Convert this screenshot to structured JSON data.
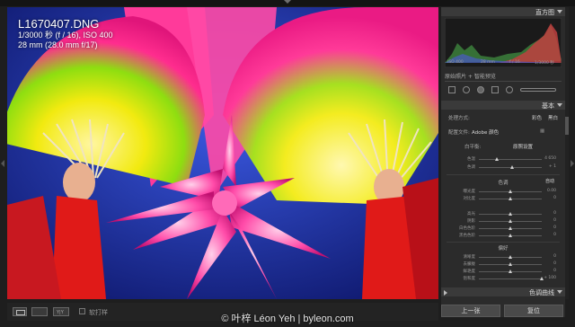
{
  "photo_overlay": {
    "filename": "L1670407.DNG",
    "exposure_line": "1/3000 秒 (f / 16), ISO 400",
    "lens_line": "28 mm (28.0 mm f/17)"
  },
  "toolbar": {
    "view_icon": "loupe-view-icon",
    "ab_icon": "before-after-icon",
    "yy_label": "Y|Y",
    "mask_label": "软打样"
  },
  "watermark": "© 叶梓 Léon Yeh | byleon.com",
  "right_panel": {
    "histogram": {
      "title": "直方图",
      "iso": "ISO 400",
      "focal": "28 mm",
      "aperture": "f / 16",
      "shutter": "1/3000 秒"
    },
    "original_label": "原始照片 + 智能预览",
    "basic": {
      "title": "基本",
      "treatment_label": "处理方式:",
      "treatment_color": "彩色",
      "treatment_bw": "黑白",
      "profile_label": "配置文件:",
      "profile_value": "Adobe 颜色",
      "wb_label": "白平衡:",
      "wb_value": "原照设置",
      "temp_label": "色温",
      "temp_value": "4 650",
      "tint_label": "色调",
      "tint_value": "+ 1",
      "tone_title": "色调",
      "auto_label": "自动",
      "exposure_label": "曝光度",
      "exposure_value": "0.00",
      "contrast_label": "对比度",
      "contrast_value": "0",
      "highlights_label": "高光",
      "highlights_value": "0",
      "shadows_label": "阴影",
      "shadows_value": "0",
      "whites_label": "白色色阶",
      "whites_value": "0",
      "blacks_label": "黑色色阶",
      "blacks_value": "0",
      "presence_title": "偏好",
      "clarity_label": "清晰度",
      "clarity_value": "0",
      "dehaze_label": "去朦胧",
      "dehaze_value": "0",
      "vibrance_label": "鲜艳度",
      "vibrance_value": "0",
      "saturation_label": "饱和度",
      "saturation_value": "+ 100"
    },
    "tone_curve_title": "色调曲线",
    "prev_button": "上一张",
    "reset_button": "复位"
  },
  "colors": {
    "panel_bg": "#2b2b2b",
    "header_bg": "#3a3a3a",
    "accent_pink": "#ff2a8a",
    "accent_yellow": "#e8e000"
  }
}
